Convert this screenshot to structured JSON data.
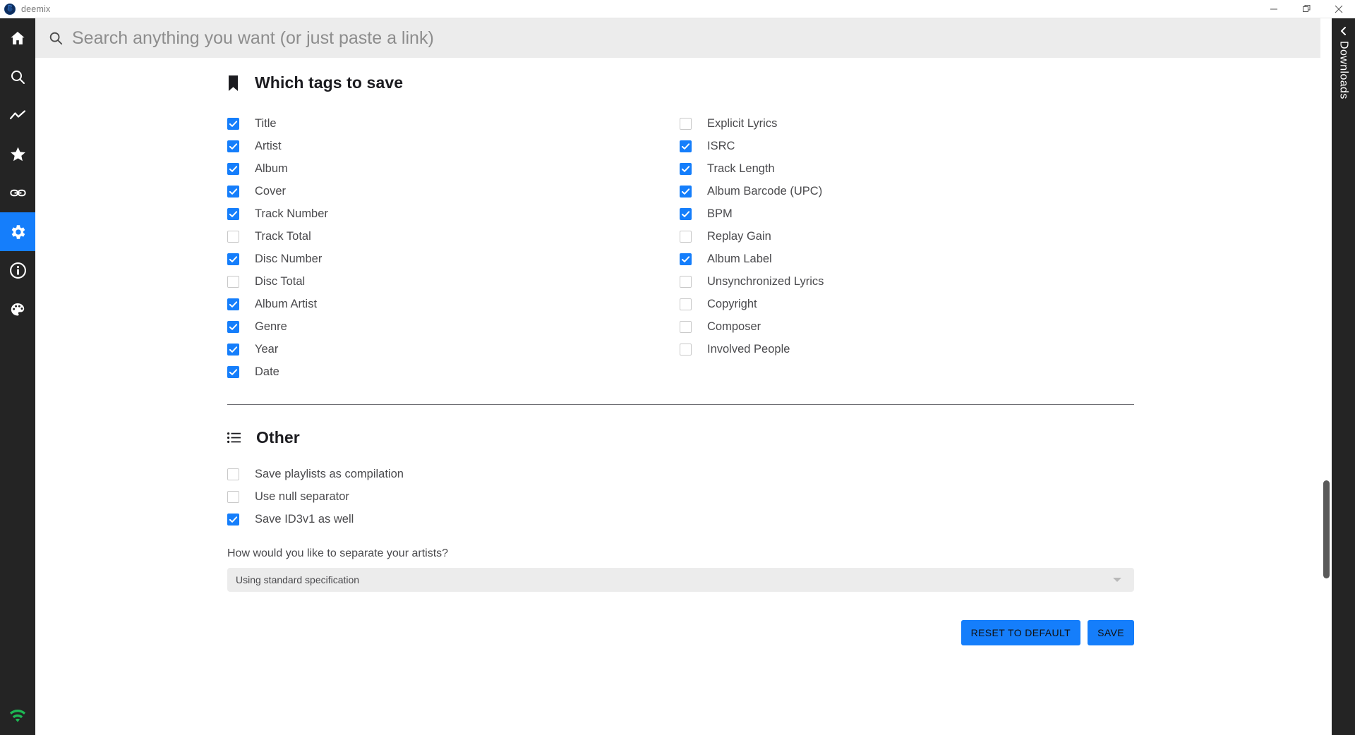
{
  "window": {
    "app_title": "deemix",
    "app_icon": "deemix-logo-icon",
    "controls": {
      "minimize": "minimize-icon",
      "maximize": "maximize-icon",
      "close": "close-icon"
    }
  },
  "search": {
    "icon": "search-icon",
    "placeholder": "Search anything you want (or just paste a link)",
    "value": ""
  },
  "sidebar": {
    "items": [
      {
        "icon": "home-icon",
        "name": "home",
        "active": false
      },
      {
        "icon": "search-icon",
        "name": "search",
        "active": false
      },
      {
        "icon": "chart-line-icon",
        "name": "charts",
        "active": false
      },
      {
        "icon": "star-icon",
        "name": "favorites",
        "active": false
      },
      {
        "icon": "link-icon",
        "name": "links",
        "active": false
      },
      {
        "icon": "gear-icon",
        "name": "settings",
        "active": true
      },
      {
        "icon": "info-icon",
        "name": "about",
        "active": false
      },
      {
        "icon": "palette-icon",
        "name": "themes",
        "active": false
      }
    ],
    "status": {
      "icon": "wifi-icon",
      "color": "#1db954"
    }
  },
  "downloads_drawer": {
    "label": "Downloads",
    "chevron": "chevron-left-icon"
  },
  "tags_section": {
    "icon": "bookmark-icon",
    "title": "Which tags to save",
    "left_column": [
      {
        "label": "Title",
        "checked": true
      },
      {
        "label": "Artist",
        "checked": true
      },
      {
        "label": "Album",
        "checked": true
      },
      {
        "label": "Cover",
        "checked": true
      },
      {
        "label": "Track Number",
        "checked": true
      },
      {
        "label": "Track Total",
        "checked": false
      },
      {
        "label": "Disc Number",
        "checked": true
      },
      {
        "label": "Disc Total",
        "checked": false
      },
      {
        "label": "Album Artist",
        "checked": true
      },
      {
        "label": "Genre",
        "checked": true
      },
      {
        "label": "Year",
        "checked": true
      },
      {
        "label": "Date",
        "checked": true
      }
    ],
    "right_column": [
      {
        "label": "Explicit Lyrics",
        "checked": false
      },
      {
        "label": "ISRC",
        "checked": true
      },
      {
        "label": "Track Length",
        "checked": true
      },
      {
        "label": "Album Barcode (UPC)",
        "checked": true
      },
      {
        "label": "BPM",
        "checked": true
      },
      {
        "label": "Replay Gain",
        "checked": false
      },
      {
        "label": "Album Label",
        "checked": true
      },
      {
        "label": "Unsynchronized Lyrics",
        "checked": false
      },
      {
        "label": "Copyright",
        "checked": false
      },
      {
        "label": "Composer",
        "checked": false
      },
      {
        "label": "Involved People",
        "checked": false
      }
    ]
  },
  "other_section": {
    "icon": "list-icon",
    "title": "Other",
    "options": [
      {
        "label": "Save playlists as compilation",
        "checked": false
      },
      {
        "label": "Use null separator",
        "checked": false
      },
      {
        "label": "Save ID3v1 as well",
        "checked": true
      }
    ],
    "artist_separator": {
      "label": "How would you like to separate your artists?",
      "value": "Using standard specification",
      "arrow": "chevron-down-icon"
    }
  },
  "footer": {
    "reset_label": "RESET TO DEFAULT",
    "save_label": "SAVE"
  },
  "colors": {
    "accent": "#157efb",
    "sidebar_bg": "#242424",
    "searchbar_bg": "#ececec",
    "status_green": "#1db954"
  }
}
